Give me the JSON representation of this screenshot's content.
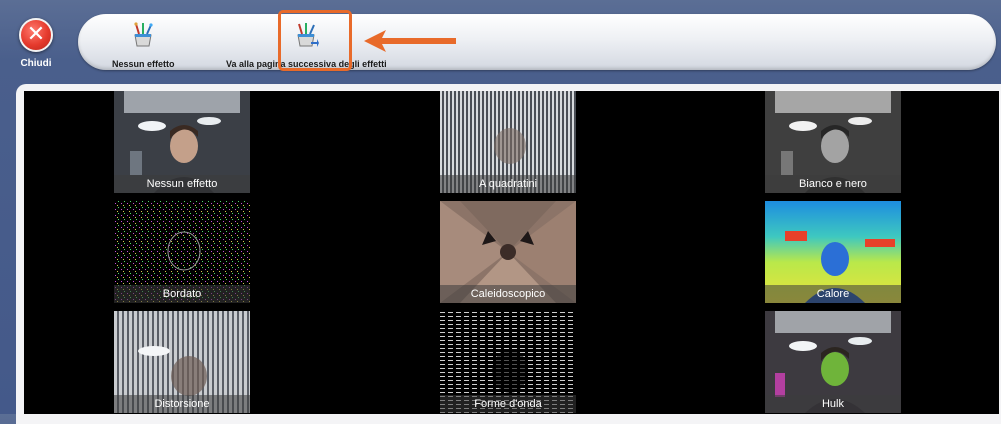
{
  "close": {
    "label": "Chiudi",
    "glyph": "✕",
    "icon": "close-icon",
    "color": "#e53a2d"
  },
  "toolbar": {
    "items": [
      {
        "label": "Nessun effetto",
        "icon": "paint-brushes-icon"
      },
      {
        "label": "Va alla pagina successiva degli effetti",
        "icon": "paint-brushes-arrow-icon"
      }
    ],
    "highlight_color": "#e86a2a"
  },
  "effects": [
    {
      "label": "Nessun effetto",
      "style": "normal"
    },
    {
      "label": "A quadratini",
      "style": "striped"
    },
    {
      "label": "Bianco e nero",
      "style": "grayscale"
    },
    {
      "label": "Bordato",
      "style": "edges"
    },
    {
      "label": "Caleidoscopico",
      "style": "kaleidoscope"
    },
    {
      "label": "Calore",
      "style": "thermal"
    },
    {
      "label": "Distorsione",
      "style": "distortion"
    },
    {
      "label": "Forme d'onda",
      "style": "waveform"
    },
    {
      "label": "Hulk",
      "style": "green"
    }
  ]
}
